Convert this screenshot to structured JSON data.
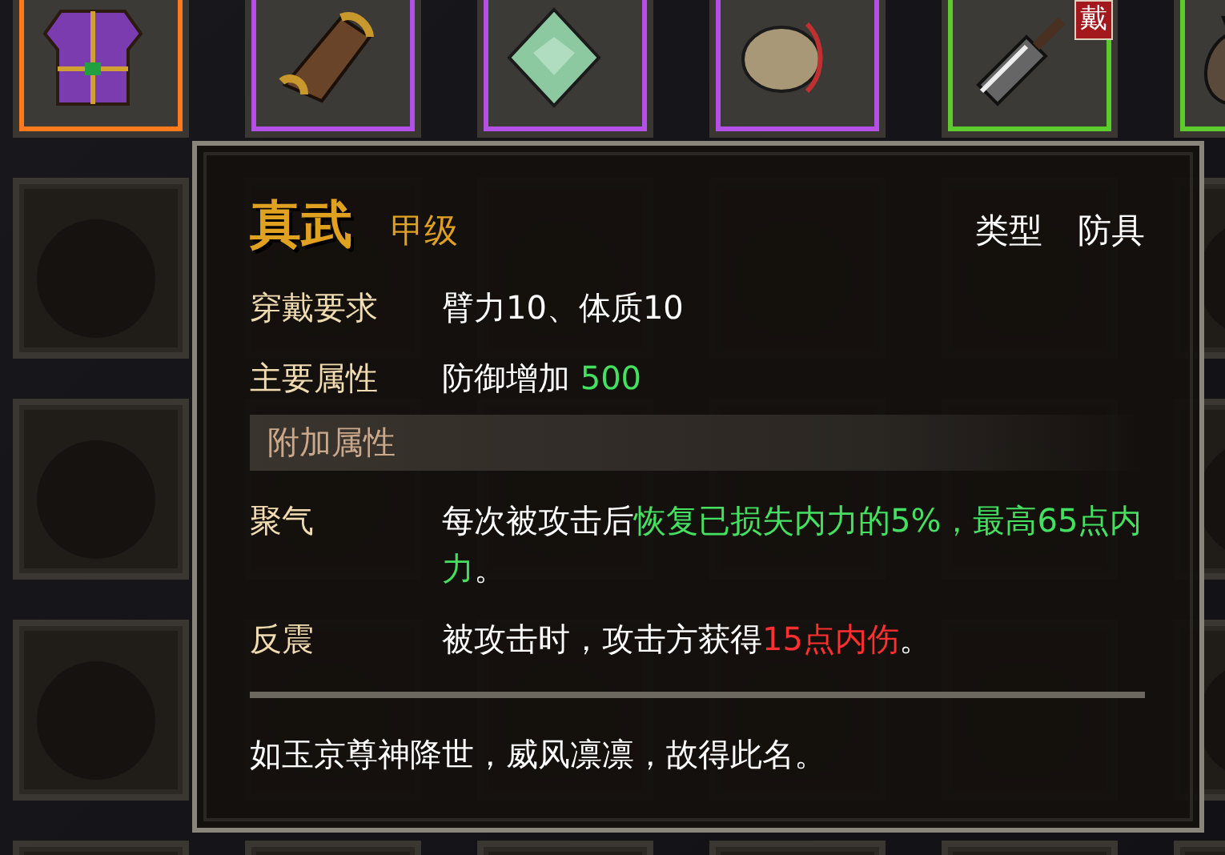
{
  "inventory": {
    "slots": [
      {
        "kind": "armor",
        "color": "#ff7a1a"
      },
      {
        "kind": "scroll",
        "color": "#b450e6"
      },
      {
        "kind": "jade",
        "color": "#b450e6"
      },
      {
        "kind": "pouch",
        "color": "#b450e6"
      },
      {
        "kind": "cleaver",
        "color": "#5ccc2c",
        "badge": "戴"
      },
      {
        "kind": "sack",
        "color": "#5ccc2c"
      }
    ]
  },
  "tooltip": {
    "name": "真武",
    "grade": "甲级",
    "type_label": "类型",
    "type_value": "防具",
    "attributes": [
      {
        "label": "穿戴要求",
        "segments": [
          {
            "text": "臂力10、体质10",
            "color": "#ffffff"
          }
        ]
      },
      {
        "label": "主要属性",
        "segments": [
          {
            "text": "防御增加 ",
            "color": "#ffffff"
          },
          {
            "text": "500",
            "color": "#44e060"
          }
        ]
      }
    ],
    "extra_header": "附加属性",
    "extras": [
      {
        "label": "聚气",
        "segments": [
          {
            "text": "每次被攻击后",
            "color": "#ffffff"
          },
          {
            "text": "恢复已损失内力的5%，最高65点内力",
            "color": "#44e060"
          },
          {
            "text": "。",
            "color": "#ffffff"
          }
        ]
      },
      {
        "label": "反震",
        "segments": [
          {
            "text": "被攻击时，攻击方获得",
            "color": "#ffffff"
          },
          {
            "text": "15点内伤",
            "color": "#ff3030"
          },
          {
            "text": "。",
            "color": "#ffffff"
          }
        ]
      }
    ],
    "flavor": "如玉京尊神降世，威风凛凛，故得此名。"
  }
}
